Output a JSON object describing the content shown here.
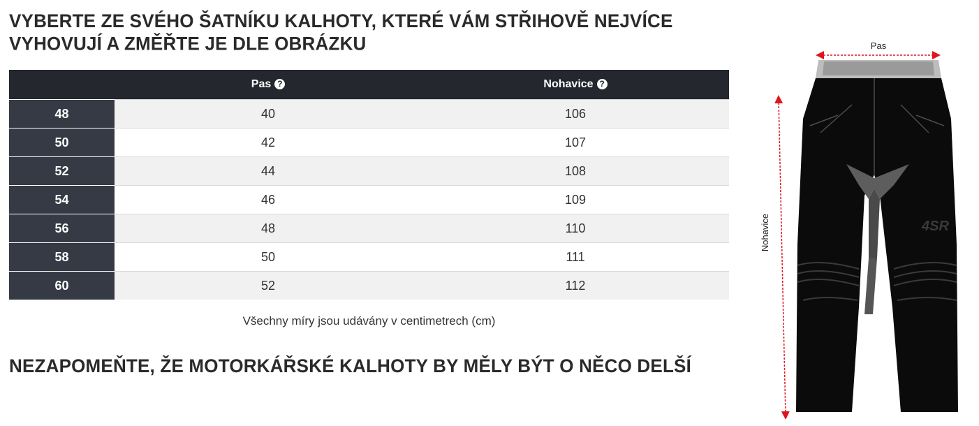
{
  "heading_top": "VYBERTE ZE SVÉHO ŠATNÍKU KALHOTY, KTERÉ VÁM STŘIHOVĚ NEJVÍCE VYHOVUJÍ A ZMĚŘTE JE DLE OBRÁZKU",
  "table": {
    "columns": [
      {
        "label": "Pas",
        "help_icon": "question-circle-icon"
      },
      {
        "label": "Nohavice",
        "help_icon": "question-circle-icon"
      }
    ],
    "rows": [
      {
        "size": "48",
        "pas": "40",
        "nohavice": "106"
      },
      {
        "size": "50",
        "pas": "42",
        "nohavice": "107"
      },
      {
        "size": "52",
        "pas": "44",
        "nohavice": "108"
      },
      {
        "size": "54",
        "pas": "46",
        "nohavice": "109"
      },
      {
        "size": "56",
        "pas": "48",
        "nohavice": "110"
      },
      {
        "size": "58",
        "pas": "50",
        "nohavice": "111"
      },
      {
        "size": "60",
        "pas": "52",
        "nohavice": "112"
      }
    ]
  },
  "note": "Všechny míry jsou udávány v centimetrech (cm)",
  "heading_bottom": "NEZAPOMEŇTE, ŽE MOTORKÁŘSKÉ KALHOTY BY MĚLY BÝT O NĚCO DELŠÍ",
  "figure": {
    "waist_label": "Pas",
    "length_label": "Nohavice",
    "logo_text": "4SR"
  },
  "colors": {
    "header_bg": "#24272e",
    "size_cell_bg": "#363a44",
    "stripe": "#f1f1f1",
    "arrow": "#e0141e"
  }
}
